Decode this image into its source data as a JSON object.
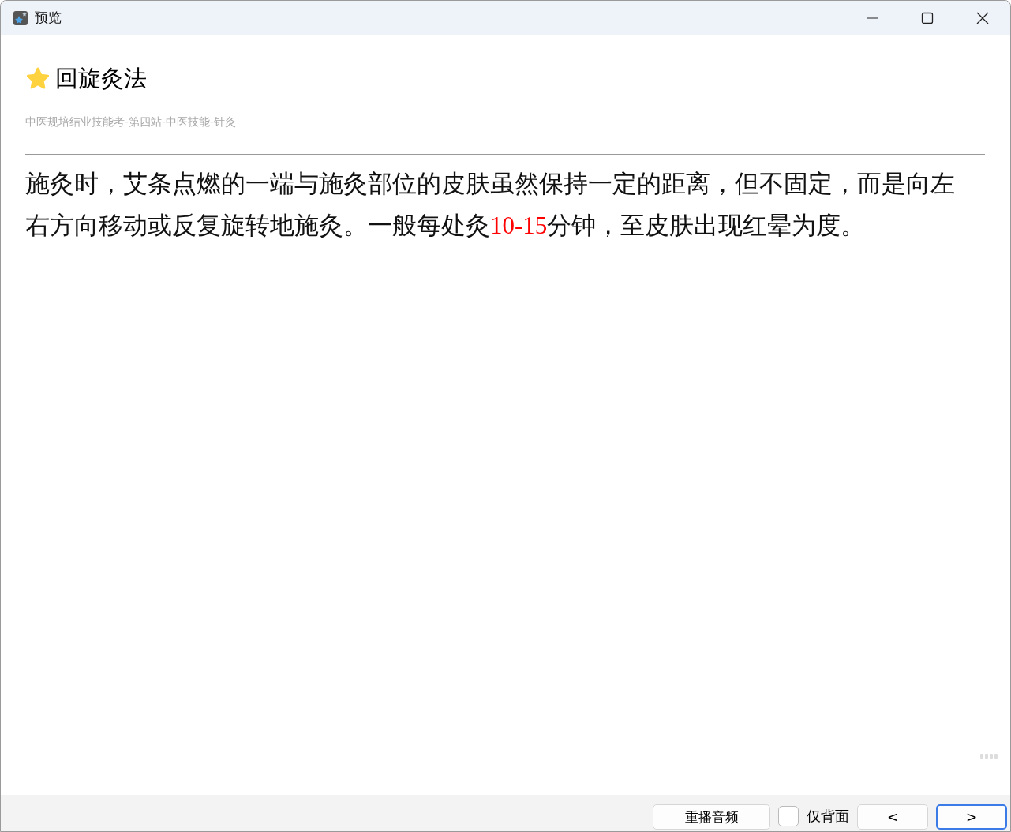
{
  "window": {
    "title": "预览"
  },
  "card": {
    "title": "回旋灸法",
    "starred": true,
    "path": "中医规培结业技能考-第四站-中医技能-针灸",
    "body": [
      {
        "text": "施灸时，艾条点燃的一端与施灸部位的皮肤虽然保持一定的距离，但不固定，而是向左右方向移动或反复旋转地施灸。一般每处灸",
        "highlight": false
      },
      {
        "text": "10-15",
        "highlight": true
      },
      {
        "text": "分钟，至皮肤出现红晕为度。",
        "highlight": false
      }
    ]
  },
  "footer": {
    "replay": {
      "label": "重播音频",
      "focused": false
    },
    "back_only": {
      "label": "仅背面",
      "checked": false
    },
    "nav": [
      {
        "label": "<",
        "focused": false
      },
      {
        "label": ">",
        "focused": true
      }
    ]
  }
}
